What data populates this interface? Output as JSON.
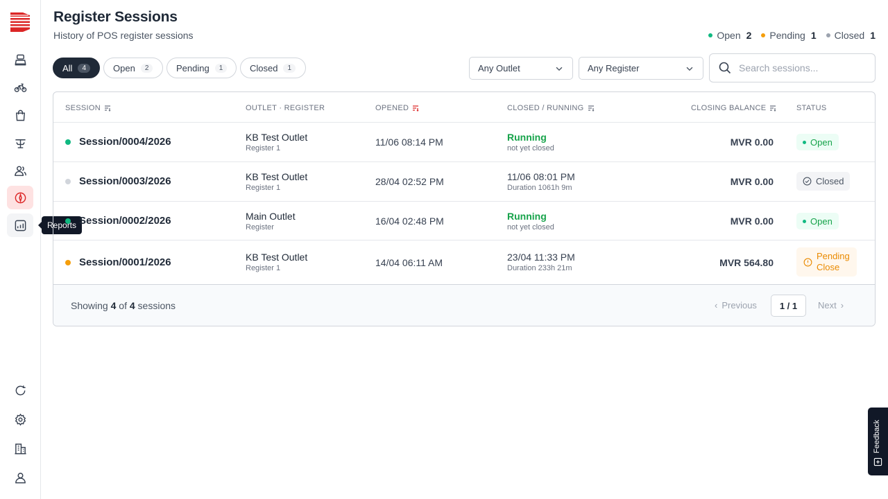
{
  "app": {
    "brand_colors": {
      "accent": "#dc2626",
      "open": "#10b981",
      "pending": "#f59e0b",
      "closed": "#9ca3af"
    }
  },
  "sidebar": {
    "items": [
      {
        "name": "register-icon"
      },
      {
        "name": "bike-icon"
      },
      {
        "name": "shopping-bag-icon"
      },
      {
        "name": "dining-table-icon"
      },
      {
        "name": "users-icon"
      },
      {
        "name": "compass-icon",
        "active": true
      },
      {
        "name": "reports-icon",
        "tooltip": "Reports"
      },
      {
        "name": "refresh-icon"
      },
      {
        "name": "gear-icon"
      },
      {
        "name": "building-icon"
      },
      {
        "name": "user-icon"
      }
    ],
    "tooltip": "Reports"
  },
  "header": {
    "title": "Register Sessions",
    "subtitle": "History of POS register sessions",
    "summary": [
      {
        "label": "Open",
        "count": "2",
        "color": "#10b981"
      },
      {
        "label": "Pending",
        "count": "1",
        "color": "#f59e0b"
      },
      {
        "label": "Closed",
        "count": "1",
        "color": "#9ca3af"
      }
    ]
  },
  "filters": {
    "pills": [
      {
        "label": "All",
        "count": "4",
        "active": true
      },
      {
        "label": "Open",
        "count": "2"
      },
      {
        "label": "Pending",
        "count": "1"
      },
      {
        "label": "Closed",
        "count": "1"
      }
    ],
    "outlet_select": "Any Outlet",
    "register_select": "Any Register",
    "search_placeholder": "Search sessions..."
  },
  "table": {
    "columns": {
      "session": "SESSION",
      "outlet": "OUTLET · REGISTER",
      "opened": "OPENED",
      "closed": "CLOSED / RUNNING",
      "balance": "CLOSING BALANCE",
      "status": "STATUS"
    },
    "rows": [
      {
        "session": "Session/0004/2026",
        "dot": "#10b981",
        "outlet": "KB Test Outlet",
        "register": "Register 1",
        "opened": "11/06 08:14 PM",
        "closed_main": "Running",
        "closed_sub": "not yet closed",
        "running": true,
        "balance": "MVR 0.00",
        "status": "Open",
        "status_type": "open"
      },
      {
        "session": "Session/0003/2026",
        "dot": "#d1d5db",
        "outlet": "KB Test Outlet",
        "register": "Register 1",
        "opened": "28/04 02:52 PM",
        "closed_main": "11/06 08:01 PM",
        "closed_sub": "Duration 1061h 9m",
        "running": false,
        "balance": "MVR 0.00",
        "status": "Closed",
        "status_type": "closed"
      },
      {
        "session": "Session/0002/2026",
        "dot": "#10b981",
        "outlet": "Main Outlet",
        "register": "Register",
        "opened": "16/04 02:48 PM",
        "closed_main": "Running",
        "closed_sub": "not yet closed",
        "running": true,
        "balance": "MVR 0.00",
        "status": "Open",
        "status_type": "open"
      },
      {
        "session": "Session/0001/2026",
        "dot": "#f59e0b",
        "outlet": "KB Test Outlet",
        "register": "Register 1",
        "opened": "14/04 06:11 AM",
        "closed_main": "23/04 11:33 PM",
        "closed_sub": "Duration 233h 21m",
        "running": false,
        "balance": "MVR 564.80",
        "status_line1": "Pending",
        "status_line2": "Close",
        "status_type": "pending"
      }
    ]
  },
  "footer": {
    "showing_prefix": "Showing",
    "shown": "4",
    "of": "of",
    "total": "4",
    "suffix": "sessions",
    "previous": "Previous",
    "page": "1 / 1",
    "next": "Next"
  },
  "feedback": {
    "label": "Feedback"
  }
}
